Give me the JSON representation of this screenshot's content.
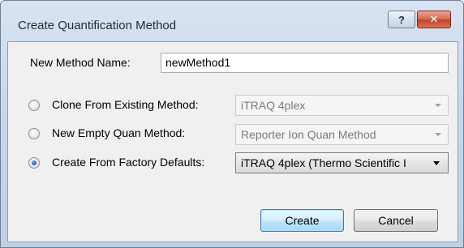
{
  "window": {
    "title": "Create Quantification Method",
    "help_label": "?",
    "close_label": "✕"
  },
  "form": {
    "name_label": "New Method Name:",
    "name_value": "newMethod1",
    "options": [
      {
        "label": "Clone From Existing Method:",
        "selected": false,
        "combo_value": "iTRAQ 4plex",
        "combo_enabled": false
      },
      {
        "label": "New Empty Quan Method:",
        "selected": false,
        "combo_value": "Reporter Ion Quan Method",
        "combo_enabled": false
      },
      {
        "label": "Create From Factory Defaults:",
        "selected": true,
        "combo_value": "iTRAQ 4plex (Thermo Scientific I",
        "combo_enabled": true
      }
    ]
  },
  "buttons": {
    "create_label": "Create",
    "cancel_label": "Cancel"
  }
}
